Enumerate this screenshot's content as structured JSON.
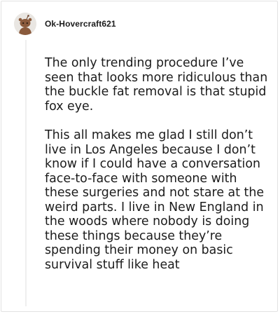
{
  "comment": {
    "author": {
      "username": "Ok-Hovercraft621",
      "avatar_icon": "snoo-avatar-icon"
    },
    "paragraphs": [
      "The only trending procedure I’ve seen that looks more ridiculous than the buckle fat removal is that stupid fox eye.",
      "This all makes me glad I still don’t live in Los Angeles because I don’t know if I could have a conversation face-to-face with someone with these surgeries and not stare at the weird parts. I live in New England in the woods where nobody is doing these things because they’re spending their money on basic survival stuff like heat"
    ]
  },
  "colors": {
    "text": "#1c1c1c",
    "thread_line": "#efefef",
    "avatar_bg": "#e9e6e2",
    "avatar_figure": "#8a5a3c"
  }
}
